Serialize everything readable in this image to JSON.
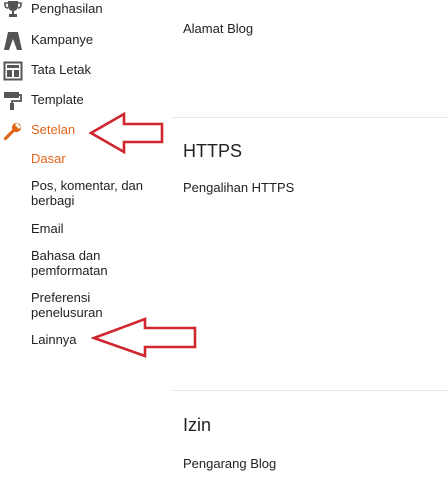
{
  "sidebar": {
    "items": [
      {
        "label": "Penghasilan",
        "icon": "trophy-icon"
      },
      {
        "label": "Kampanye",
        "icon": "campaign-icon"
      },
      {
        "label": "Tata Letak",
        "icon": "layout-icon"
      },
      {
        "label": "Template",
        "icon": "paint-roller-icon"
      },
      {
        "label": "Setelan",
        "icon": "wrench-icon",
        "active": true
      }
    ],
    "sub_items": [
      {
        "label": "Dasar",
        "active": true
      },
      {
        "label": "Pos, komentar, dan berbagi"
      },
      {
        "label": "Email"
      },
      {
        "label": "Bahasa dan pemformatan"
      },
      {
        "label": "Preferensi penelusuran"
      },
      {
        "label": "Lainnya"
      }
    ]
  },
  "main": {
    "blog_address_label": "Alamat Blog",
    "https_section": {
      "title": "HTTPS",
      "redirect_label": "Pengalihan HTTPS"
    },
    "permissions_section": {
      "title": "Izin",
      "authors_label": "Pengarang Blog"
    }
  },
  "colors": {
    "accent": "#e0661b",
    "annotation_arrow": "#d0262d",
    "icon": "#555555",
    "text": "#222222"
  }
}
